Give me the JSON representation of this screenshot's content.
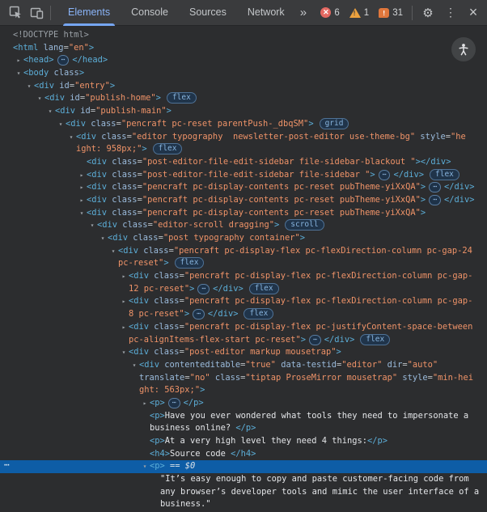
{
  "devtools": {
    "toolbar": {
      "tabs": [
        {
          "label": "Elements",
          "active": true
        },
        {
          "label": "Console",
          "active": false
        },
        {
          "label": "Sources",
          "active": false
        },
        {
          "label": "Network",
          "active": false
        }
      ],
      "more_tabs_glyph": "»",
      "error_count": "6",
      "warning_count": "1",
      "issue_count": "31",
      "error_glyph": "✕",
      "warning_glyph": "!",
      "issue_glyph": "!",
      "settings_glyph": "⚙",
      "menu_glyph": "⋮",
      "close_glyph": "×"
    },
    "colors": {
      "accent_blue": "#8ab4f8",
      "tab_underline": "#76a6f2",
      "error_red": "#e46962",
      "warning_orange": "#eba13e",
      "issue_orange": "#e0773c",
      "selection_blue": "#0e5da6",
      "tag_blue": "#5caed8",
      "attribute_blue": "#9bbbdc",
      "value_orange": "#ef9368",
      "toolbar_bg": "#3a3b3d",
      "panel_bg": "#2c2d2f"
    },
    "dom_tree": {
      "ellipsis_glyph": "⋯",
      "arrow_open_glyph": "▾",
      "arrow_closed_glyph": "▸",
      "rows": [
        {
          "ind": 0,
          "seg": [
            [
              "d",
              "<!DOCTYPE html>"
            ]
          ]
        },
        {
          "ind": 0,
          "seg": [
            [
              "g",
              "<html"
            ],
            [
              "a",
              " lang"
            ],
            [
              "p",
              "="
            ],
            [
              "v",
              "\"en\""
            ],
            [
              "g",
              ">"
            ]
          ]
        },
        {
          "ind": 1,
          "arrow": "closed",
          "seg": [
            [
              "g",
              "<head>"
            ],
            [
              "e",
              ""
            ],
            [
              "g",
              "</head>"
            ]
          ]
        },
        {
          "ind": 1,
          "arrow": "open",
          "seg": [
            [
              "g",
              "<body"
            ],
            [
              "a",
              " class"
            ],
            [
              "g",
              ">"
            ]
          ]
        },
        {
          "ind": 2,
          "arrow": "open",
          "seg": [
            [
              "g",
              "<div"
            ],
            [
              "a",
              " id"
            ],
            [
              "p",
              "="
            ],
            [
              "v",
              "\"entry\""
            ],
            [
              "g",
              ">"
            ]
          ]
        },
        {
          "ind": 3,
          "arrow": "open",
          "seg": [
            [
              "g",
              "<div"
            ],
            [
              "a",
              " id"
            ],
            [
              "p",
              "="
            ],
            [
              "v",
              "\"publish-home\""
            ],
            [
              "g",
              ">"
            ],
            [
              "b",
              "flex"
            ]
          ]
        },
        {
          "ind": 4,
          "arrow": "open",
          "seg": [
            [
              "g",
              "<div"
            ],
            [
              "a",
              " id"
            ],
            [
              "p",
              "="
            ],
            [
              "v",
              "\"publish-main\""
            ],
            [
              "g",
              ">"
            ]
          ]
        },
        {
          "ind": 5,
          "arrow": "open",
          "seg": [
            [
              "g",
              "<div"
            ],
            [
              "a",
              " class"
            ],
            [
              "p",
              "="
            ],
            [
              "v",
              "\"pencraft pc-reset parentPush-_dbqSM\""
            ],
            [
              "g",
              ">"
            ],
            [
              "b",
              "grid"
            ]
          ]
        },
        {
          "ind": 6,
          "arrow": "open",
          "seg": [
            [
              "g",
              "<div"
            ],
            [
              "a",
              " class"
            ],
            [
              "p",
              "="
            ],
            [
              "v",
              "\"editor typography  newsletter-post-editor use-theme-bg\""
            ],
            [
              "a",
              " style"
            ],
            [
              "p",
              "="
            ],
            [
              "v",
              "\"he"
            ]
          ]
        },
        {
          "ind": 6,
          "cont": true,
          "seg": [
            [
              "v",
              "ight: 958px;\""
            ],
            [
              "g",
              ">"
            ],
            [
              "b",
              "flex"
            ]
          ]
        },
        {
          "ind": 7,
          "seg": [
            [
              "g",
              "<div"
            ],
            [
              "a",
              " class"
            ],
            [
              "p",
              "="
            ],
            [
              "v",
              "\"post-editor-file-edit-sidebar file-sidebar-blackout \""
            ],
            [
              "g",
              "></div>"
            ]
          ]
        },
        {
          "ind": 7,
          "arrow": "closed",
          "seg": [
            [
              "g",
              "<div"
            ],
            [
              "a",
              " class"
            ],
            [
              "p",
              "="
            ],
            [
              "v",
              "\"post-editor-file-edit-sidebar file-sidebar \""
            ],
            [
              "g",
              ">"
            ],
            [
              "e",
              ""
            ],
            [
              "g",
              "</div>"
            ],
            [
              "b",
              "flex"
            ]
          ]
        },
        {
          "ind": 7,
          "arrow": "closed",
          "seg": [
            [
              "g",
              "<div"
            ],
            [
              "a",
              " class"
            ],
            [
              "p",
              "="
            ],
            [
              "v",
              "\"pencraft pc-display-contents pc-reset pubTheme-yiXxQA\""
            ],
            [
              "g",
              ">"
            ],
            [
              "e",
              ""
            ],
            [
              "g",
              "</div>"
            ]
          ]
        },
        {
          "ind": 7,
          "arrow": "closed",
          "seg": [
            [
              "g",
              "<div"
            ],
            [
              "a",
              " class"
            ],
            [
              "p",
              "="
            ],
            [
              "v",
              "\"pencraft pc-display-contents pc-reset pubTheme-yiXxQA\""
            ],
            [
              "g",
              ">"
            ],
            [
              "e",
              ""
            ],
            [
              "g",
              "</div>"
            ]
          ]
        },
        {
          "ind": 7,
          "arrow": "open",
          "seg": [
            [
              "g",
              "<div"
            ],
            [
              "a",
              " class"
            ],
            [
              "p",
              "="
            ],
            [
              "v",
              "\"pencraft pc-display-contents pc-reset pubTheme-yiXxQA\""
            ],
            [
              "g",
              ">"
            ]
          ]
        },
        {
          "ind": 8,
          "arrow": "open",
          "seg": [
            [
              "g",
              "<div"
            ],
            [
              "a",
              " class"
            ],
            [
              "p",
              "="
            ],
            [
              "v",
              "\"editor-scroll dragging\""
            ],
            [
              "g",
              ">"
            ],
            [
              "b",
              "scroll"
            ]
          ]
        },
        {
          "ind": 9,
          "arrow": "open",
          "seg": [
            [
              "g",
              "<div"
            ],
            [
              "a",
              " class"
            ],
            [
              "p",
              "="
            ],
            [
              "v",
              "\"post typography container\""
            ],
            [
              "g",
              ">"
            ]
          ]
        },
        {
          "ind": 10,
          "arrow": "open",
          "seg": [
            [
              "g",
              "<div"
            ],
            [
              "a",
              " class"
            ],
            [
              "p",
              "="
            ],
            [
              "v",
              "\"pencraft pc-display-flex pc-flexDirection-column pc-gap-24"
            ]
          ]
        },
        {
          "ind": 10,
          "cont": true,
          "seg": [
            [
              "v",
              "pc-reset\""
            ],
            [
              "g",
              ">"
            ],
            [
              "b",
              "flex"
            ]
          ]
        },
        {
          "ind": 11,
          "arrow": "closed",
          "seg": [
            [
              "g",
              "<div"
            ],
            [
              "a",
              " class"
            ],
            [
              "p",
              "="
            ],
            [
              "v",
              "\"pencraft pc-display-flex pc-flexDirection-column pc-gap-"
            ]
          ]
        },
        {
          "ind": 11,
          "cont": true,
          "seg": [
            [
              "v",
              "12 pc-reset\""
            ],
            [
              "g",
              ">"
            ],
            [
              "e",
              ""
            ],
            [
              "g",
              "</div>"
            ],
            [
              "b",
              "flex"
            ]
          ]
        },
        {
          "ind": 11,
          "arrow": "closed",
          "seg": [
            [
              "g",
              "<div"
            ],
            [
              "a",
              " class"
            ],
            [
              "p",
              "="
            ],
            [
              "v",
              "\"pencraft pc-display-flex pc-flexDirection-column pc-gap-"
            ]
          ]
        },
        {
          "ind": 11,
          "cont": true,
          "seg": [
            [
              "v",
              "8 pc-reset\""
            ],
            [
              "g",
              ">"
            ],
            [
              "e",
              ""
            ],
            [
              "g",
              "</div>"
            ],
            [
              "b",
              "flex"
            ]
          ]
        },
        {
          "ind": 11,
          "arrow": "closed",
          "seg": [
            [
              "g",
              "<div"
            ],
            [
              "a",
              " class"
            ],
            [
              "p",
              "="
            ],
            [
              "v",
              "\"pencraft pc-display-flex pc-justifyContent-space-between"
            ]
          ]
        },
        {
          "ind": 11,
          "cont": true,
          "seg": [
            [
              "v",
              "pc-alignItems-flex-start pc-reset\""
            ],
            [
              "g",
              ">"
            ],
            [
              "e",
              ""
            ],
            [
              "g",
              "</div>"
            ],
            [
              "b",
              "flex"
            ]
          ]
        },
        {
          "ind": 11,
          "arrow": "open",
          "seg": [
            [
              "g",
              "<div"
            ],
            [
              "a",
              " class"
            ],
            [
              "p",
              "="
            ],
            [
              "v",
              "\"post-editor markup mousetrap\""
            ],
            [
              "g",
              ">"
            ]
          ]
        },
        {
          "ind": 12,
          "arrow": "open",
          "seg": [
            [
              "g",
              "<div"
            ],
            [
              "a",
              " contenteditable"
            ],
            [
              "p",
              "="
            ],
            [
              "v",
              "\"true\""
            ],
            [
              "a",
              " data-testid"
            ],
            [
              "p",
              "="
            ],
            [
              "v",
              "\"editor\""
            ],
            [
              "a",
              " dir"
            ],
            [
              "p",
              "="
            ],
            [
              "v",
              "\"auto\""
            ]
          ]
        },
        {
          "ind": 12,
          "cont": true,
          "seg": [
            [
              "a",
              "translate"
            ],
            [
              "p",
              "="
            ],
            [
              "v",
              "\"no\""
            ],
            [
              "a",
              " class"
            ],
            [
              "p",
              "="
            ],
            [
              "v",
              "\"tiptap ProseMirror mousetrap\""
            ],
            [
              "a",
              " style"
            ],
            [
              "p",
              "="
            ],
            [
              "v",
              "\"min-hei"
            ]
          ]
        },
        {
          "ind": 12,
          "cont": true,
          "seg": [
            [
              "v",
              "ght: 563px;\""
            ],
            [
              "g",
              ">"
            ]
          ]
        },
        {
          "ind": 13,
          "arrow": "closed",
          "seg": [
            [
              "g",
              "<p>"
            ],
            [
              "e",
              ""
            ],
            [
              "g",
              "</p>"
            ]
          ]
        },
        {
          "ind": 13,
          "seg": [
            [
              "g",
              "<p>"
            ],
            [
              "t",
              "Have you ever wondered what tools they need to impersonate a"
            ]
          ]
        },
        {
          "ind": 13,
          "cont": true,
          "seg": [
            [
              "t",
              "business online? "
            ],
            [
              "g",
              "</p>"
            ]
          ]
        },
        {
          "ind": 13,
          "seg": [
            [
              "g",
              "<p>"
            ],
            [
              "t",
              "At a very high level they need 4 things:"
            ],
            [
              "g",
              "</p>"
            ]
          ]
        },
        {
          "ind": 13,
          "seg": [
            [
              "g",
              "<h4>"
            ],
            [
              "t",
              "Source code "
            ],
            [
              "g",
              "</h4>"
            ]
          ]
        },
        {
          "ind": 13,
          "arrow": "open",
          "selected": true,
          "gutter": true,
          "seg": [
            [
              "g",
              "<p>"
            ],
            [
              "q",
              " == $0"
            ]
          ]
        },
        {
          "ind": 14,
          "seg": [
            [
              "t",
              "\"It’s easy enough to copy and paste customer-facing code from"
            ]
          ]
        },
        {
          "ind": 14,
          "cont": true,
          "seg": [
            [
              "t",
              "any browser’s developer tools and mimic the user interface of a"
            ]
          ]
        },
        {
          "ind": 14,
          "cont": true,
          "seg": [
            [
              "t",
              "business.\""
            ]
          ]
        }
      ]
    }
  }
}
